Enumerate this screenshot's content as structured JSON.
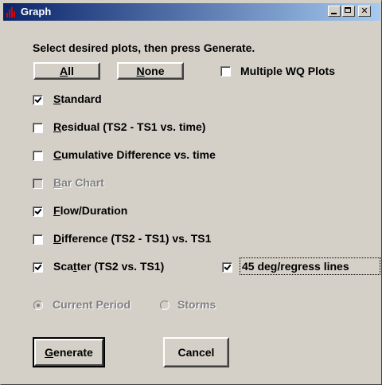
{
  "window": {
    "title": "Graph",
    "titlebar_colors": [
      "#0a246a",
      "#a6caf0"
    ],
    "face_color": "#d4d0c8"
  },
  "instruction": "Select desired plots, then press Generate.",
  "buttons": {
    "all": {
      "pre": "",
      "key": "A",
      "post": "ll"
    },
    "none": {
      "pre": "",
      "key": "N",
      "post": "one"
    },
    "generate": {
      "pre": "",
      "key": "G",
      "post": "enerate"
    },
    "cancel": "Cancel"
  },
  "multiple_wq": {
    "label": "Multiple WQ Plots",
    "checked": false
  },
  "plots": [
    {
      "pre": "",
      "key": "S",
      "post": "tandard",
      "checked": true,
      "enabled": true
    },
    {
      "pre": "",
      "key": "R",
      "post": "esidual (TS2 - TS1 vs. time)",
      "checked": false,
      "enabled": true
    },
    {
      "pre": "",
      "key": "C",
      "post": "umulative Difference vs. time",
      "checked": false,
      "enabled": true
    },
    {
      "pre": "",
      "key": "B",
      "post": "ar Chart",
      "checked": false,
      "enabled": false
    },
    {
      "pre": "",
      "key": "F",
      "post": "low/Duration",
      "checked": true,
      "enabled": true
    },
    {
      "pre": "",
      "key": "D",
      "post": "ifference (TS2 - TS1) vs. TS1",
      "checked": false,
      "enabled": true
    },
    {
      "pre": "Sca",
      "key": "t",
      "post": "ter (TS2  vs. TS1)",
      "checked": true,
      "enabled": true
    }
  ],
  "regress_lines": {
    "label": "45 deg/regress lines",
    "checked": true
  },
  "period": {
    "current": {
      "label": "Current Period",
      "selected": true,
      "enabled": false
    },
    "storms": {
      "label": "Storms",
      "selected": false,
      "enabled": false
    }
  }
}
